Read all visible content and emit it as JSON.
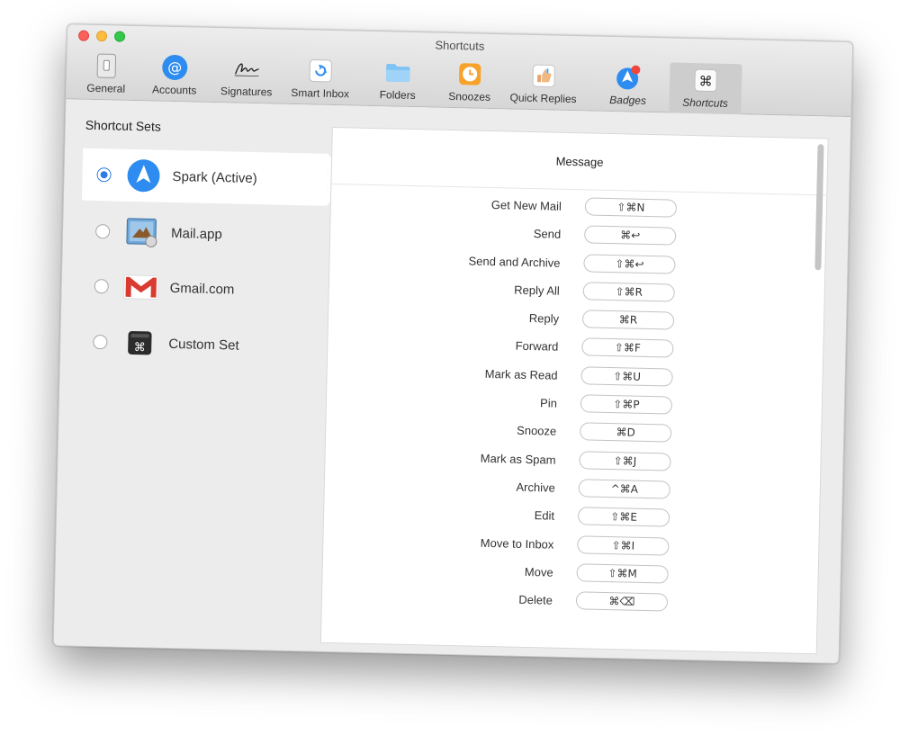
{
  "window": {
    "title": "Shortcuts"
  },
  "toolbar": [
    {
      "name": "general",
      "label": "General",
      "icon": "switch-icon"
    },
    {
      "name": "accounts",
      "label": "Accounts",
      "icon": "at-sign-icon"
    },
    {
      "name": "signatures",
      "label": "Signatures",
      "icon": "signature-icon"
    },
    {
      "name": "smart-inbox",
      "label": "Smart Inbox",
      "icon": "smart-inbox-icon"
    },
    {
      "name": "folders",
      "label": "Folders",
      "icon": "folder-icon"
    },
    {
      "name": "snoozes",
      "label": "Snoozes",
      "icon": "clock-icon"
    },
    {
      "name": "quick-replies",
      "label": "Quick Replies",
      "icon": "thumbs-up-icon"
    },
    {
      "name": "badges",
      "label": "Badges",
      "icon": "badge-icon"
    },
    {
      "name": "shortcuts",
      "label": "Shortcuts",
      "icon": "command-icon",
      "selected": true
    }
  ],
  "sidebar": {
    "heading": "Shortcut Sets",
    "sets": [
      {
        "label": "Spark (Active)",
        "icon": "spark-icon",
        "selected": true
      },
      {
        "label": "Mail.app",
        "icon": "mail-app-icon",
        "selected": false
      },
      {
        "label": "Gmail.com",
        "icon": "gmail-icon",
        "selected": false
      },
      {
        "label": "Custom Set",
        "icon": "custom-set-icon",
        "selected": false
      }
    ]
  },
  "panel": {
    "header": "Message",
    "shortcuts": [
      {
        "label": "Get New Mail",
        "keys": "⇧⌘N"
      },
      {
        "label": "Send",
        "keys": "⌘↩"
      },
      {
        "label": "Send and Archive",
        "keys": "⇧⌘↩"
      },
      {
        "label": "Reply All",
        "keys": "⇧⌘R"
      },
      {
        "label": "Reply",
        "keys": "⌘R"
      },
      {
        "label": "Forward",
        "keys": "⇧⌘F"
      },
      {
        "label": "Mark as Read",
        "keys": "⇧⌘U"
      },
      {
        "label": "Pin",
        "keys": "⇧⌘P"
      },
      {
        "label": "Snooze",
        "keys": "⌘D"
      },
      {
        "label": "Mark as Spam",
        "keys": "⇧⌘J"
      },
      {
        "label": "Archive",
        "keys": "^⌘A"
      },
      {
        "label": "Edit",
        "keys": "⇧⌘E"
      },
      {
        "label": "Move to Inbox",
        "keys": "⇧⌘I"
      },
      {
        "label": "Move",
        "keys": "⇧⌘M"
      },
      {
        "label": "Delete",
        "keys": "⌘⌫"
      }
    ]
  },
  "colors": {
    "accent": "#2a7be3",
    "close": "#fc605b",
    "minimize": "#fdbc40",
    "maximize": "#34c84a"
  }
}
